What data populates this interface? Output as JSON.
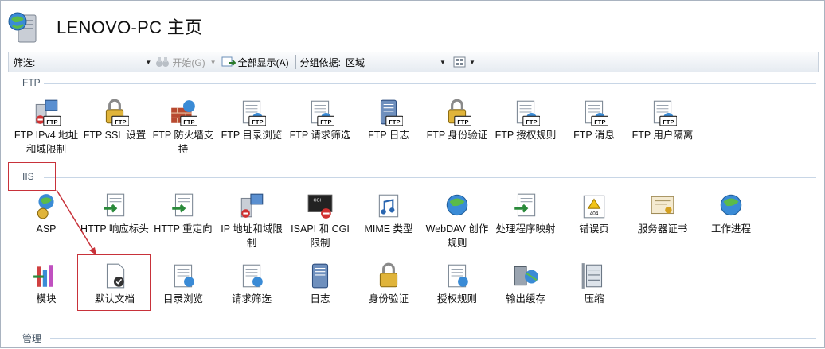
{
  "header": {
    "title": "LENOVO-PC 主页",
    "icon": "server-globe-icon"
  },
  "toolbar": {
    "filter_label": "筛选:",
    "filter_value": "",
    "start_label": "开始(G)",
    "show_all_label": "全部显示(A)",
    "group_by_label": "分组依据:",
    "group_by_value": "区域",
    "view_icon": "view-mode-icon"
  },
  "sections": {
    "ftp": {
      "title": "FTP",
      "items": [
        {
          "label": "FTP IPv4 地址和域限制",
          "icon": "ftp-ip-restrict-icon"
        },
        {
          "label": "FTP SSL 设置",
          "icon": "ftp-ssl-lock-icon"
        },
        {
          "label": "FTP 防火墙支持",
          "icon": "ftp-firewall-icon"
        },
        {
          "label": "FTP 目录浏览",
          "icon": "ftp-directory-browse-icon"
        },
        {
          "label": "FTP 请求筛选",
          "icon": "ftp-request-filter-icon"
        },
        {
          "label": "FTP 日志",
          "icon": "ftp-log-icon"
        },
        {
          "label": "FTP 身份验证",
          "icon": "ftp-auth-icon"
        },
        {
          "label": "FTP 授权规则",
          "icon": "ftp-authorization-icon"
        },
        {
          "label": "FTP 消息",
          "icon": "ftp-messages-icon"
        },
        {
          "label": "FTP 用户隔离",
          "icon": "ftp-user-isolation-icon"
        }
      ]
    },
    "iis": {
      "title": "IIS",
      "row1": [
        {
          "label": "ASP",
          "icon": "asp-icon"
        },
        {
          "label": "HTTP 响应标头",
          "icon": "http-response-headers-icon"
        },
        {
          "label": "HTTP 重定向",
          "icon": "http-redirect-icon"
        },
        {
          "label": "IP 地址和域限制",
          "icon": "ip-restrict-icon"
        },
        {
          "label": "ISAPI 和 CGI 限制",
          "icon": "isapi-cgi-icon"
        },
        {
          "label": "MIME 类型",
          "icon": "mime-types-icon"
        },
        {
          "label": "WebDAV 创作规则",
          "icon": "webdav-icon"
        },
        {
          "label": "处理程序映射",
          "icon": "handler-mappings-icon"
        },
        {
          "label": "错误页",
          "icon": "error-pages-icon"
        },
        {
          "label": "服务器证书",
          "icon": "server-certificates-icon"
        },
        {
          "label": "工作进程",
          "icon": "worker-processes-icon"
        }
      ],
      "row2": [
        {
          "label": "模块",
          "icon": "modules-icon"
        },
        {
          "label": "默认文档",
          "icon": "default-document-icon"
        },
        {
          "label": "目录浏览",
          "icon": "directory-browse-icon"
        },
        {
          "label": "请求筛选",
          "icon": "request-filter-icon"
        },
        {
          "label": "日志",
          "icon": "log-icon"
        },
        {
          "label": "身份验证",
          "icon": "authentication-icon"
        },
        {
          "label": "授权规则",
          "icon": "authorization-icon"
        },
        {
          "label": "输出缓存",
          "icon": "output-cache-icon"
        },
        {
          "label": "压缩",
          "icon": "compression-icon"
        }
      ]
    },
    "manage": {
      "title": "管理"
    }
  },
  "colors": {
    "highlight": "#c8323a",
    "section_line": "#c8d6e6",
    "accent_blue": "#1f63b7"
  }
}
